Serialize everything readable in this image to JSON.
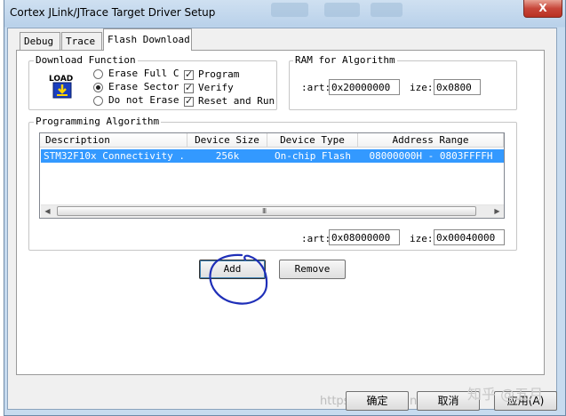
{
  "window": {
    "title": "Cortex JLink/JTrace Target Driver Setup",
    "close_glyph": "X"
  },
  "tabs": [
    {
      "label": "Debug"
    },
    {
      "label": "Trace"
    },
    {
      "label": "Flash Download"
    }
  ],
  "download_function": {
    "group_label": "Download Function",
    "icon_text": "LOAD",
    "erase_options": [
      {
        "label": "Erase Full C",
        "selected": false
      },
      {
        "label": "Erase Sector",
        "selected": true
      },
      {
        "label": "Do not Erase",
        "selected": false
      }
    ],
    "checks": [
      {
        "label": "Program",
        "checked": true
      },
      {
        "label": "Verify",
        "checked": true
      },
      {
        "label": "Reset and Run",
        "checked": true
      }
    ]
  },
  "ram_for_algorithm": {
    "group_label": "RAM for Algorithm",
    "start_label": ":art:",
    "start_value": "0x20000000",
    "size_label": "ize:",
    "size_value": "0x0800"
  },
  "programming_algorithm": {
    "group_label": "Programming Algorithm",
    "columns": [
      "Description",
      "Device Size",
      "Device Type",
      "Address Range"
    ],
    "rows": [
      {
        "description": "STM32F10x Connectivity ...",
        "device_size": "256k",
        "device_type": "On-chip Flash",
        "address_range": "08000000H - 0803FFFFH"
      }
    ],
    "scroll_grip": "III",
    "start_label": ":art:",
    "start_value": "0x08000000",
    "size_label": "ize:",
    "size_value": "0x00040000"
  },
  "buttons": {
    "add": "Add",
    "remove": "Remove"
  },
  "footer": {
    "ok": "确定",
    "cancel": "取消",
    "apply": "应用(A)",
    "watermark_url": "https://blog.csdn.net",
    "watermark_brand": "知乎 @五月"
  },
  "colors": {
    "selection": "#3399ff",
    "annotation_circle": "#1f2fb8",
    "close_button": "#c7463a"
  }
}
